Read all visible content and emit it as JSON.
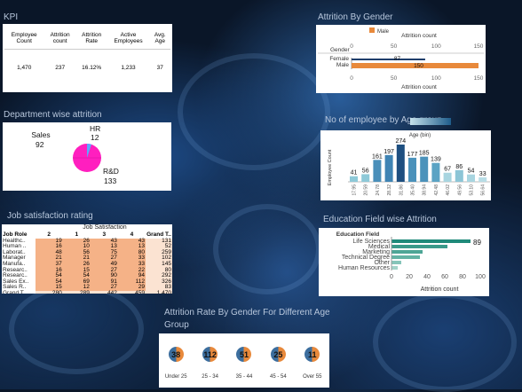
{
  "titles": {
    "kpi": "KPI",
    "gender": "Attrition By Gender",
    "dept": "Department wise attrition",
    "age": "No of employee by Age group",
    "jobsat": "Job satisfaction rating",
    "edu": "Education Field wise Attrition",
    "rate": "Attrition Rate By Gender For Different Age Group"
  },
  "kpi": {
    "headers": [
      "Employee Count",
      "Attrition count",
      "Attrition Rate",
      "Active Employees",
      "Avg. Age"
    ],
    "values": [
      "1,470",
      "237",
      "16.12%",
      "1,233",
      "37"
    ]
  },
  "gender_chart": {
    "legend_label": "Male",
    "top_axis_title": "Attrition count",
    "bottom_axis_title": "Attrition count",
    "row_header": "Gender",
    "rows": [
      "Female",
      "Male"
    ],
    "values": [
      87,
      150
    ],
    "ticks": [
      "0",
      "50",
      "100",
      "150"
    ],
    "colors": {
      "male": "#e8893b",
      "female": "#1f3e6b"
    }
  },
  "dept_chart": {
    "labels": [
      {
        "name": "Sales",
        "value": "92"
      },
      {
        "name": "HR",
        "value": "12"
      },
      {
        "name": "R&D",
        "value": "133"
      }
    ],
    "colors": [
      "#ff1fbf",
      "#5aa9ff",
      "#ff1fbf"
    ]
  },
  "age_chart": {
    "xlabel": "Age (bin)",
    "ylabel": "Employee Count",
    "categories": [
      "17.95",
      "20.59",
      "24.78",
      "28.32",
      "31.86",
      "35.40",
      "38.94",
      "42.48",
      "46.02",
      "49.56",
      "53.10",
      "56.64"
    ],
    "values": [
      41,
      56,
      161,
      197,
      274,
      177,
      185,
      139,
      67,
      86,
      54,
      33
    ]
  },
  "job_sat": {
    "title": "Job Satisfaction",
    "headers": [
      "Job Role",
      "2",
      "1",
      "3",
      "4",
      "Grand T.."
    ],
    "rows": [
      [
        "Healthc..",
        "19",
        "26",
        "43",
        "43",
        "131"
      ],
      [
        "Human ..",
        "16",
        "10",
        "13",
        "13",
        "52"
      ],
      [
        "Laborat..",
        "48",
        "56",
        "75",
        "80",
        "259"
      ],
      [
        "Manager",
        "21",
        "21",
        "27",
        "33",
        "102"
      ],
      [
        "Manufa..",
        "37",
        "26",
        "49",
        "33",
        "145"
      ],
      [
        "Researc..",
        "16",
        "15",
        "27",
        "22",
        "80"
      ],
      [
        "Researc..",
        "54",
        "54",
        "90",
        "94",
        "292"
      ],
      [
        "Sales Ex..",
        "54",
        "69",
        "91",
        "112",
        "326"
      ],
      [
        "Sales R..",
        "15",
        "12",
        "27",
        "29",
        "83"
      ],
      [
        "Grand T..",
        "280",
        "289",
        "442",
        "459",
        "1,470"
      ]
    ]
  },
  "edu_chart": {
    "title": "Education Field",
    "categories": [
      "Life Sciences",
      "Medical",
      "Marketing",
      "Technical Degree",
      "Other",
      "Human Resources"
    ],
    "values": [
      89,
      63,
      35,
      32,
      11,
      7
    ],
    "labeled_value": "89",
    "xlabel": "Attrition count",
    "ticks": [
      "0",
      "20",
      "40",
      "60",
      "80",
      "100"
    ]
  },
  "rate_chart": {
    "groups": [
      {
        "label": "Under 25",
        "value": "38"
      },
      {
        "label": "25 - 34",
        "value": "112"
      },
      {
        "label": "35 - 44",
        "value": "51"
      },
      {
        "label": "45 - 54",
        "value": "25"
      },
      {
        "label": "Over 55",
        "value": "11"
      }
    ],
    "colors": {
      "a": "#e8893b",
      "b": "#3c6e9e"
    }
  }
}
